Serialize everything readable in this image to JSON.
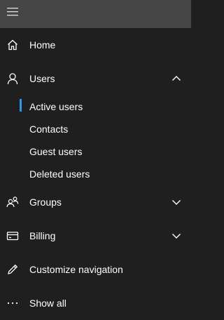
{
  "nav": {
    "home_label": "Home",
    "users_label": "Users",
    "users_sub": {
      "active_users": "Active users",
      "contacts": "Contacts",
      "guest_users": "Guest users",
      "deleted_users": "Deleted users"
    },
    "groups_label": "Groups",
    "billing_label": "Billing",
    "customize_label": "Customize navigation",
    "show_all_label": "Show all"
  },
  "colors": {
    "background": "#1f1f1f",
    "topbar": "#454545",
    "accent": "#2899f5"
  },
  "icons": {
    "menu": "hamburger-menu-icon",
    "home": "home-icon",
    "users": "person-icon",
    "groups": "people-icon",
    "billing": "credit-card-icon",
    "customize": "pencil-icon",
    "show_all": "ellipsis-icon"
  }
}
